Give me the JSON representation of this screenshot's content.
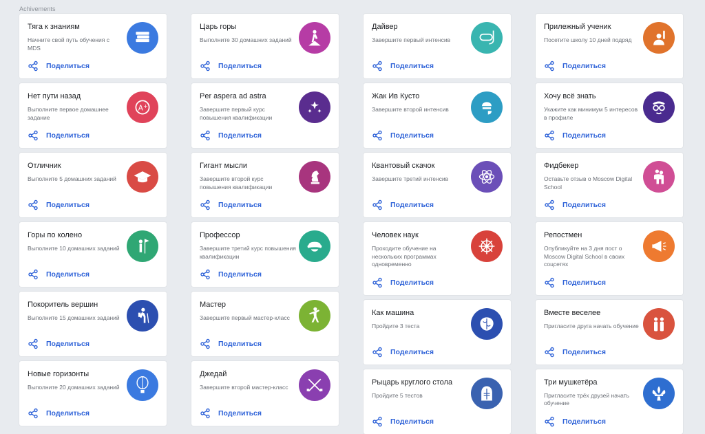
{
  "section_title": "Achivements",
  "share_label": "Поделиться",
  "columns": [
    [
      {
        "title": "Тяга к знаниям",
        "desc": "Начните свой путь обучения с MDS",
        "icon": "books-icon",
        "color": "#3b7ae0"
      },
      {
        "title": "Нет пути назад",
        "desc": "Выполните первое домашнее задание",
        "icon": "grade-a-plus-icon",
        "color": "#e0435a"
      },
      {
        "title": "Отличник",
        "desc": "Выполните 5 домашних заданий",
        "icon": "graduation-cap-icon",
        "color": "#d94b45"
      },
      {
        "title": "Горы по колено",
        "desc": "Выполните 10 домашних заданий",
        "icon": "flag-person-icon",
        "color": "#2fa774"
      },
      {
        "title": "Покоритель вершин",
        "desc": "Выполните 15 домашних заданий",
        "icon": "hiker-icon",
        "color": "#2c4fb0"
      },
      {
        "title": "Новые горизонты",
        "desc": "Выполните 20 домашних заданий",
        "icon": "hot-air-balloon-icon",
        "color": "#3b7ae0"
      }
    ],
    [
      {
        "title": "Царь горы",
        "desc": "Выполните 30 домашних заданий",
        "icon": "summit-icon",
        "color": "#b63ca5"
      },
      {
        "title": "Per aspera ad astra",
        "desc": "Завершите первый курс повышения квалификации",
        "icon": "stars-icon",
        "color": "#5a2d8f"
      },
      {
        "title": "Гигант мысли",
        "desc": "Завершите второй курс повышения квалификации",
        "icon": "chess-knight-icon",
        "color": "#a8357e"
      },
      {
        "title": "Профессор",
        "desc": "Завершите третий курс повышения квалификации",
        "icon": "professor-icon",
        "color": "#29ab8d"
      },
      {
        "title": "Мастер",
        "desc": "Завершите первый мастер-класс",
        "icon": "karate-icon",
        "color": "#7cb334"
      },
      {
        "title": "Джедай",
        "desc": "Завершите второй мастер-класс",
        "icon": "lightsabers-icon",
        "color": "#8a3fb0"
      }
    ],
    [
      {
        "title": "Дайвер",
        "desc": "Завершите первый интенсив",
        "icon": "diving-mask-icon",
        "color": "#39b5b0"
      },
      {
        "title": "Жак Ив Кусто",
        "desc": "Завершите второй интенсив",
        "icon": "diver-pipe-icon",
        "color": "#2d9dc4"
      },
      {
        "title": "Квантовый скачок",
        "desc": "Завершите третий интенсив",
        "icon": "atom-icon",
        "color": "#6b4fb8"
      },
      {
        "title": "Человек наук",
        "desc": "Проходите обучение на нескольких программах одновременно",
        "icon": "ship-wheel-icon",
        "color": "#d8423b"
      },
      {
        "title": "Как машина",
        "desc": "Пройдите 3 теста",
        "icon": "brain-icon",
        "color": "#2c4fb0"
      },
      {
        "title": "Рыцарь круглого стола",
        "desc": "Пройдите 5 тестов",
        "icon": "knight-helmet-icon",
        "color": "#3a62b0"
      }
    ],
    [
      {
        "title": "Прилежный ученик",
        "desc": "Посетите школу 10 дней подряд",
        "icon": "student-raise-hand-icon",
        "color": "#e0732c"
      },
      {
        "title": "Хочу всё знать",
        "desc": "Укажите как минимум 5 интересов в профиле",
        "icon": "nerd-face-icon",
        "color": "#4a2b8f"
      },
      {
        "title": "Фидбекер",
        "desc": "Оставьте отзыв о Moscow Digital School",
        "icon": "hug-icon",
        "color": "#d04e95"
      },
      {
        "title": "Репостмен",
        "desc": "Опубликуйте на 3 дня пост о Moscow Digital School в своих соцсетях",
        "icon": "megaphone-icon",
        "color": "#ee7a30"
      },
      {
        "title": "Вместе веселее",
        "desc": "Пригласите друга начать обучение",
        "icon": "friends-icon",
        "color": "#d9533e"
      },
      {
        "title": "Три мушкетёра",
        "desc": "Пригласите трёх друзей начать обучение",
        "icon": "fleur-de-lis-icon",
        "color": "#2e6ed0"
      }
    ]
  ]
}
